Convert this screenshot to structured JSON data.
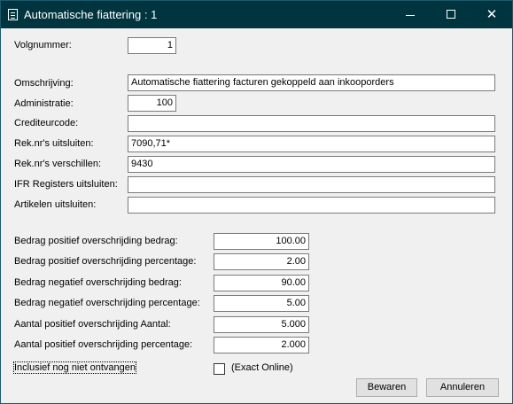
{
  "window": {
    "title": "Automatische fiattering : 1",
    "minimize_glyph": "",
    "maximize_glyph": "",
    "close_glyph": "✕"
  },
  "form": {
    "volgnummer": {
      "label": "Volgnummer:",
      "value": "1"
    },
    "omschrijving": {
      "label": "Omschrijving:",
      "value": "Automatische fiattering facturen gekoppeld aan inkooporders"
    },
    "administratie": {
      "label": "Administratie:",
      "value": "100"
    },
    "crediteurcode": {
      "label": "Crediteurcode:",
      "value": ""
    },
    "reknr_uitsluiten": {
      "label": "Rek.nr's uitsluiten:",
      "value": "7090,71*"
    },
    "reknr_verschillen": {
      "label": "Rek.nr's verschillen:",
      "value": "9430"
    },
    "ifr_registers": {
      "label": "IFR Registers uitsluiten:",
      "value": ""
    },
    "artikelen": {
      "label": "Artikelen uitsluiten:",
      "value": ""
    }
  },
  "amounts": [
    {
      "label": "Bedrag positief overschrijding bedrag:",
      "value": "100.00"
    },
    {
      "label": "Bedrag positief overschrijding percentage:",
      "value": "2.00"
    },
    {
      "label": "Bedrag negatief overschrijding bedrag:",
      "value": "90.00"
    },
    {
      "label": "Bedrag negatief overschrijding percentage:",
      "value": "5.00"
    },
    {
      "label": "Aantal positief overschrijding Aantal:",
      "value": "5.000"
    },
    {
      "label": "Aantal positief overschrijding percentage:",
      "value": "2.000"
    }
  ],
  "inclusief": {
    "label": "Inclusief nog niet ontvangen",
    "checked": false,
    "note": "(Exact Online)"
  },
  "buttons": {
    "save": "Bewaren",
    "cancel": "Annuleren"
  }
}
